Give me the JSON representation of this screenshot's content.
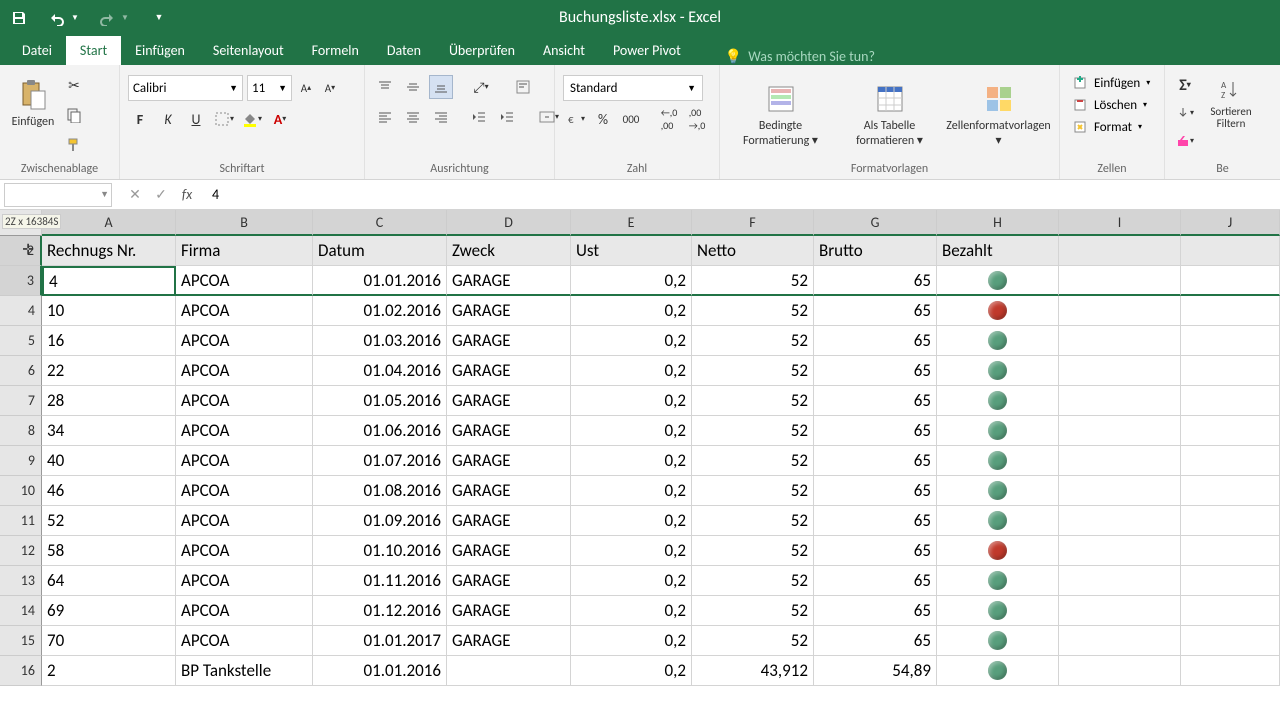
{
  "title": "Buchungsliste.xlsx - Excel",
  "qat": {
    "save": "save",
    "undo": "undo",
    "redo": "redo"
  },
  "tabs": [
    "Datei",
    "Start",
    "Einfügen",
    "Seitenlayout",
    "Formeln",
    "Daten",
    "Überprüfen",
    "Ansicht",
    "Power Pivot"
  ],
  "active_tab": "Start",
  "tellme_placeholder": "Was möchten Sie tun?",
  "ribbon": {
    "clipboard": {
      "label": "Zwischenablage",
      "paste": "Einfügen"
    },
    "font": {
      "label": "Schriftart",
      "name": "Calibri",
      "size": "11"
    },
    "alignment": {
      "label": "Ausrichtung"
    },
    "number": {
      "label": "Zahl",
      "format": "Standard"
    },
    "styles": {
      "label": "Formatvorlagen",
      "conditional": "Bedingte Formatierung ▾",
      "as_table": "Als Tabelle formatieren ▾",
      "cell_styles": "Zellenformatvorlagen ▾"
    },
    "cells": {
      "label": "Zellen",
      "insert": "Einfügen",
      "delete": "Löschen",
      "format": "Format"
    },
    "editing": {
      "label": "Be",
      "sort": "Sortieren Filtern"
    }
  },
  "namebox": "",
  "namebox_overlay": "2Z x 16384S",
  "formula_value": "4",
  "columns": [
    "A",
    "B",
    "C",
    "D",
    "E",
    "F",
    "G",
    "H",
    "I",
    "J"
  ],
  "col_widths": [
    "wA",
    "wB",
    "wC",
    "wD",
    "wE",
    "wF",
    "wG",
    "wH",
    "wI",
    "wJ"
  ],
  "headers": [
    "Rechnugs Nr.",
    "Firma",
    "Datum",
    "Zweck",
    "Ust",
    "Netto",
    "Brutto",
    "Bezahlt"
  ],
  "selected_rows": [
    2,
    3
  ],
  "active_row": 3,
  "visible_row_nums": [
    2,
    3,
    4,
    5,
    6,
    7,
    8,
    9,
    10,
    11,
    12,
    13,
    14,
    15,
    16
  ],
  "rows": [
    {
      "n": 3,
      "a": "4",
      "b": "APCOA",
      "c": "01.01.2016",
      "d": "GARAGE",
      "e": "0,2",
      "f": "52",
      "g": "65",
      "h": "green"
    },
    {
      "n": 4,
      "a": "10",
      "b": "APCOA",
      "c": "01.02.2016",
      "d": "GARAGE",
      "e": "0,2",
      "f": "52",
      "g": "65",
      "h": "red"
    },
    {
      "n": 5,
      "a": "16",
      "b": "APCOA",
      "c": "01.03.2016",
      "d": "GARAGE",
      "e": "0,2",
      "f": "52",
      "g": "65",
      "h": "green"
    },
    {
      "n": 6,
      "a": "22",
      "b": "APCOA",
      "c": "01.04.2016",
      "d": "GARAGE",
      "e": "0,2",
      "f": "52",
      "g": "65",
      "h": "green"
    },
    {
      "n": 7,
      "a": "28",
      "b": "APCOA",
      "c": "01.05.2016",
      "d": "GARAGE",
      "e": "0,2",
      "f": "52",
      "g": "65",
      "h": "green"
    },
    {
      "n": 8,
      "a": "34",
      "b": "APCOA",
      "c": "01.06.2016",
      "d": "GARAGE",
      "e": "0,2",
      "f": "52",
      "g": "65",
      "h": "green"
    },
    {
      "n": 9,
      "a": "40",
      "b": "APCOA",
      "c": "01.07.2016",
      "d": "GARAGE",
      "e": "0,2",
      "f": "52",
      "g": "65",
      "h": "green"
    },
    {
      "n": 10,
      "a": "46",
      "b": "APCOA",
      "c": "01.08.2016",
      "d": "GARAGE",
      "e": "0,2",
      "f": "52",
      "g": "65",
      "h": "green"
    },
    {
      "n": 11,
      "a": "52",
      "b": "APCOA",
      "c": "01.09.2016",
      "d": "GARAGE",
      "e": "0,2",
      "f": "52",
      "g": "65",
      "h": "green"
    },
    {
      "n": 12,
      "a": "58",
      "b": "APCOA",
      "c": "01.10.2016",
      "d": "GARAGE",
      "e": "0,2",
      "f": "52",
      "g": "65",
      "h": "red"
    },
    {
      "n": 13,
      "a": "64",
      "b": "APCOA",
      "c": "01.11.2016",
      "d": "GARAGE",
      "e": "0,2",
      "f": "52",
      "g": "65",
      "h": "green"
    },
    {
      "n": 14,
      "a": "69",
      "b": "APCOA",
      "c": "01.12.2016",
      "d": "GARAGE",
      "e": "0,2",
      "f": "52",
      "g": "65",
      "h": "green"
    },
    {
      "n": 15,
      "a": "70",
      "b": "APCOA",
      "c": "01.01.2017",
      "d": "GARAGE",
      "e": "0,2",
      "f": "52",
      "g": "65",
      "h": "green"
    },
    {
      "n": 16,
      "a": "2",
      "b": "BP Tankstelle",
      "c": "01.01.2016",
      "d": "",
      "e": "0,2",
      "f": "43,912",
      "g": "54,89",
      "h": "green"
    }
  ]
}
